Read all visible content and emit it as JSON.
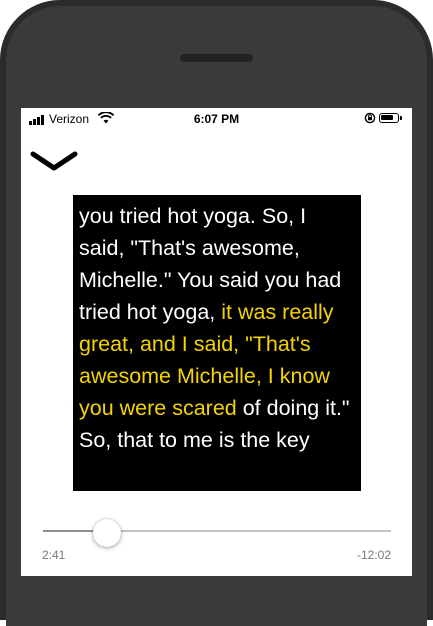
{
  "status_bar": {
    "carrier": "Verizon",
    "time": "6:07 PM"
  },
  "icons": {
    "collapse": "chevron-down-icon",
    "wifi": "wifi-icon",
    "signal": "signal-bars-icon",
    "orientation_lock": "orientation-lock-icon",
    "battery": "battery-icon"
  },
  "transcript": {
    "segments": [
      {
        "text": "you tried hot yoga. So, I said, \"That's awesome, Michelle.\" You said you had tried hot yoga, ",
        "highlight": false
      },
      {
        "text": "it was really great, and I said, \"That's awesome Michelle, I know you were scared",
        "highlight": true
      },
      {
        "text": " of doing it.\" So, that to me is the key",
        "highlight": false
      }
    ],
    "text_color": "#ffffff",
    "highlight_color": "#f5d300",
    "background": "#000000"
  },
  "player": {
    "elapsed": "2:41",
    "remaining": "-12:02",
    "progress": 0.183
  }
}
